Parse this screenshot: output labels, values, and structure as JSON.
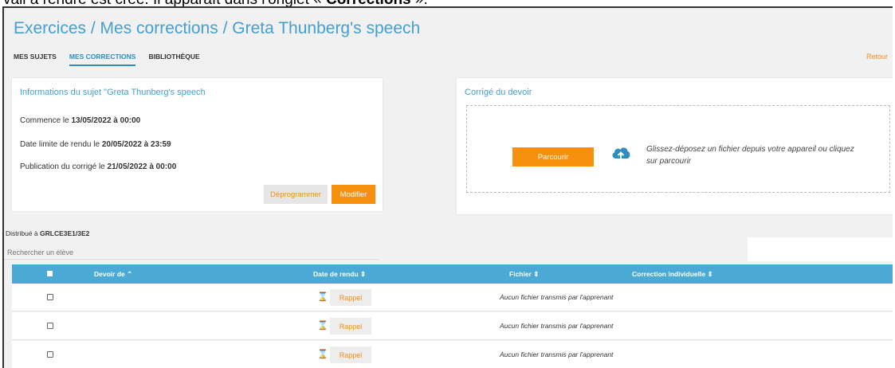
{
  "caption": {
    "text": "vail à rendre est créé. Il apparaît dans l'onglet « ",
    "bold": "Corrections",
    "end": " »."
  },
  "header": {
    "title": "Exercices / Mes corrections / Greta Thunberg's speech",
    "back_label": "Retour"
  },
  "tabs": [
    {
      "label": "MES SUJETS",
      "active": false
    },
    {
      "label": "MES CORRECTIONS",
      "active": true
    },
    {
      "label": "BIBLIOTHÈQUE",
      "active": false
    }
  ],
  "info_card": {
    "title": "Informations du sujet \"Greta Thunberg's speech",
    "start_label": "Commence le ",
    "start_value": "13/05/2022 à 00:00",
    "deadline_label": "Date limite de rendu le ",
    "deadline_value": "20/05/2022 à 23:59",
    "publication_label": "Publication du corrigé le ",
    "publication_value": "21/05/2022 à 00:00",
    "deprogram_label": "Déprogrammer",
    "modify_label": "Modifier"
  },
  "correction_card": {
    "title": "Corrigé du devoir",
    "browse_label": "Parcourir",
    "drop_text": "Glissez-déposez un fichier depuis votre appareil ou cliquez sur parcourir",
    "upload_icon": "cloud-upload-icon"
  },
  "distribution": {
    "label": "Distribué à ",
    "value": "GRLCE3E1/3E2"
  },
  "search": {
    "placeholder": "Rechercher un élève"
  },
  "table": {
    "columns": [
      {
        "label": "Devoir de ⌃"
      },
      {
        "label": "Date de rendu ⇕"
      },
      {
        "label": "Fichier ⇕"
      },
      {
        "label": "Correction individuelle ⇕"
      }
    ],
    "rows": [
      {
        "reminder_label": "Rappel",
        "file_text": "Aucun fichier transmis par l'apprenant",
        "status_icon": "hourglass-icon"
      },
      {
        "reminder_label": "Rappel",
        "file_text": "Aucun fichier transmis par l'apprenant",
        "status_icon": "hourglass-icon"
      },
      {
        "reminder_label": "Rappel",
        "file_text": "Aucun fichier transmis par l'apprenant",
        "status_icon": "hourglass-icon"
      }
    ]
  },
  "colors": {
    "accent_blue": "#44a0cf",
    "header_blue": "#4aaad5",
    "orange": "#f7900d"
  }
}
